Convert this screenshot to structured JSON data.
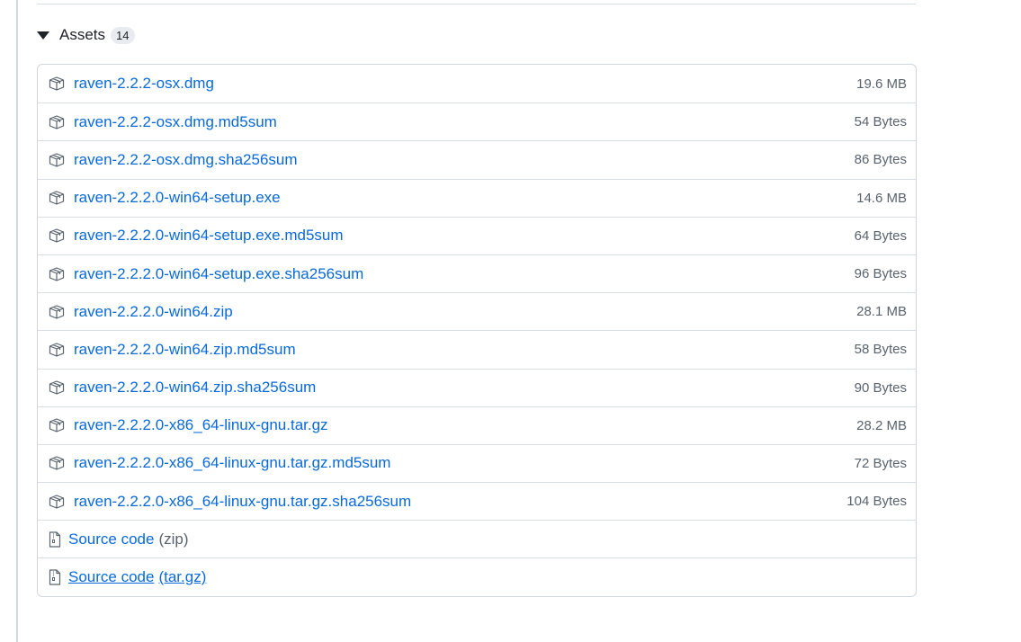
{
  "assets": {
    "title": "Assets",
    "count": "14",
    "files": [
      {
        "name": "raven-2.2.2-osx.dmg",
        "size": "19.6 MB"
      },
      {
        "name": "raven-2.2.2-osx.dmg.md5sum",
        "size": "54 Bytes"
      },
      {
        "name": "raven-2.2.2-osx.dmg.sha256sum",
        "size": "86 Bytes"
      },
      {
        "name": "raven-2.2.2.0-win64-setup.exe",
        "size": "14.6 MB"
      },
      {
        "name": "raven-2.2.2.0-win64-setup.exe.md5sum",
        "size": "64 Bytes"
      },
      {
        "name": "raven-2.2.2.0-win64-setup.exe.sha256sum",
        "size": "96 Bytes"
      },
      {
        "name": "raven-2.2.2.0-win64.zip",
        "size": "28.1 MB"
      },
      {
        "name": "raven-2.2.2.0-win64.zip.md5sum",
        "size": "58 Bytes"
      },
      {
        "name": "raven-2.2.2.0-win64.zip.sha256sum",
        "size": "90 Bytes"
      },
      {
        "name": "raven-2.2.2.0-x86_64-linux-gnu.tar.gz",
        "size": "28.2 MB"
      },
      {
        "name": "raven-2.2.2.0-x86_64-linux-gnu.tar.gz.md5sum",
        "size": "72 Bytes"
      },
      {
        "name": "raven-2.2.2.0-x86_64-linux-gnu.tar.gz.sha256sum",
        "size": "104 Bytes"
      }
    ],
    "source": [
      {
        "label": "Source code",
        "ext": "(zip)"
      },
      {
        "label": "Source code",
        "ext": "(tar.gz)"
      }
    ],
    "icons": {
      "caret": "triangle-down-icon",
      "file": "package-icon",
      "source": "file-zip-icon"
    },
    "colors": {
      "link": "#0969da",
      "muted": "#59636e",
      "border": "#d0d7de"
    }
  }
}
